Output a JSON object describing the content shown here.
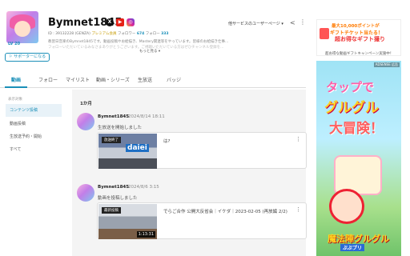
{
  "profile": {
    "name": "Bymnet1845",
    "level": "LV 20",
    "meta_id": "ID : 39132228 (GENZA)",
    "premium": "プレミアム会員",
    "followers_label": "フォロワー",
    "followers": "674",
    "following_label": "フォロー",
    "following": "333",
    "description_line1": "教習日音楽のBymnet1845です。動画投稿やお絵描き、Mastery関連等をやっています。皆様のお絵描き仕事...",
    "description_line2": "フォローいただいているみなさまありがとうございます。ご視聴いただいている方はぜひチャンネル登録を...",
    "more": "もっと見る",
    "supporter_button": "サポーターになる",
    "user_page_link": "他サービスのユーザーページ",
    "social": {
      "x": "X",
      "youtube": "▶",
      "instagram": "◎"
    }
  },
  "tabs": [
    "動画",
    "フォロー",
    "マイリスト",
    "動画・シリーズ",
    "生放送",
    "バッジ"
  ],
  "sidebar": {
    "heading": "表示対象",
    "items": [
      "コンテンツ投稿",
      "動画投稿",
      "生放送予約・開始",
      "すべて"
    ]
  },
  "feed": {
    "day_label": "1か月",
    "posts": [
      {
        "name": "Bymnet1845",
        "date": "2024/8/14 18:11",
        "text": "生放送を開始しました",
        "card": {
          "badge": "放送終了",
          "brand": "daiei",
          "title": "は?",
          "duration": ""
        }
      },
      {
        "name": "Bymnet1845",
        "date": "2024/8/6 3:15",
        "text": "動画を投稿しました",
        "card": {
          "badge": "最新投稿",
          "brand": "",
          "title": "でらご合作 公開大反省会｜イケダ｜2023-02-05 (再放編 2/2)",
          "duration": "1:13:31"
        }
      }
    ]
  },
  "ads": {
    "top_line1": "最大10,000ポイントが",
    "top_line2": "ギフトチケット当たる！",
    "top_line3": "超お得なギフト撮り",
    "top_caption": "超お得な動画ギフトキャンペーン実施中！",
    "main_label": "ADSENSE 広告",
    "main_t1": "タップで",
    "main_t2": "グルグル",
    "main_t3": "大冒険！",
    "main_logo": "魔法陣グルグル",
    "main_logo2": "ぶぶプリ"
  }
}
